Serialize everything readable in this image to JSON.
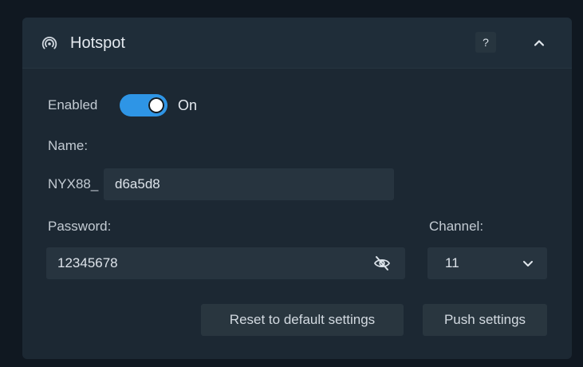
{
  "panel": {
    "title": "Hotspot",
    "icon": "hotspot-icon",
    "help_label": "?",
    "collapse_icon": "chevron-up-icon"
  },
  "enabled": {
    "label": "Enabled",
    "state_text": "On",
    "is_on": true,
    "accent": "#2e95e6"
  },
  "name": {
    "label": "Name:",
    "prefix": "NYX88_",
    "value": "d6a5d8"
  },
  "password": {
    "label": "Password:",
    "value": "12345678",
    "visibility_icon": "eye-off-icon"
  },
  "channel": {
    "label": "Channel:",
    "value": "11",
    "dropdown_icon": "chevron-down-icon"
  },
  "actions": {
    "reset_label": "Reset to default settings",
    "push_label": "Push settings"
  }
}
